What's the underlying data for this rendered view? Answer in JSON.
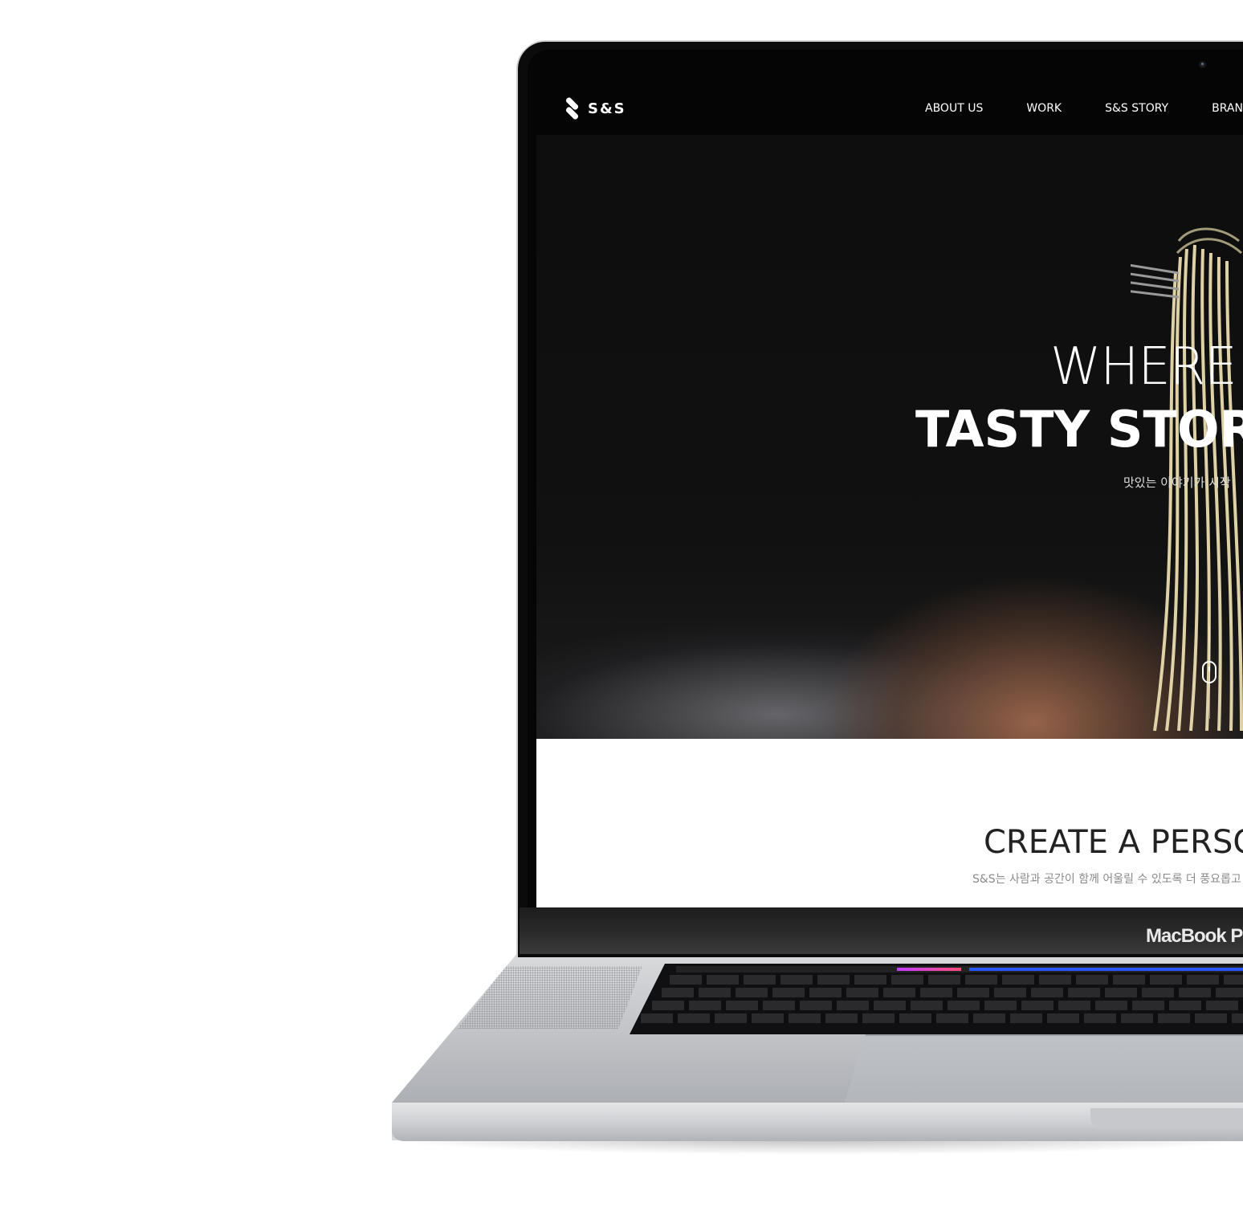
{
  "device": {
    "chin_label": "MacBook P"
  },
  "site": {
    "logo": {
      "text": "S&S"
    },
    "nav": [
      {
        "label": "ABOUT US"
      },
      {
        "label": "WORK"
      },
      {
        "label": "S&S STORY"
      },
      {
        "label": "BRAN"
      }
    ],
    "hero": {
      "line1": "WHERE",
      "line2": "TASTY STOR",
      "subtitle": "맛있는 이야기가 시작"
    },
    "section2": {
      "title": "CREATE A PERSO",
      "subtitle": "S&S는 사람과 공간이 함께 어울릴 수 있도록 더 풍요롭고"
    }
  },
  "colors": {
    "hero_background": "#0d0d0d",
    "nav_text": "#ffffff",
    "section_title": "#222222",
    "section_subtitle": "#8a8a8a"
  },
  "icons": [
    "logo-mark-icon",
    "scroll-mouse-icon",
    "camera-icon"
  ]
}
